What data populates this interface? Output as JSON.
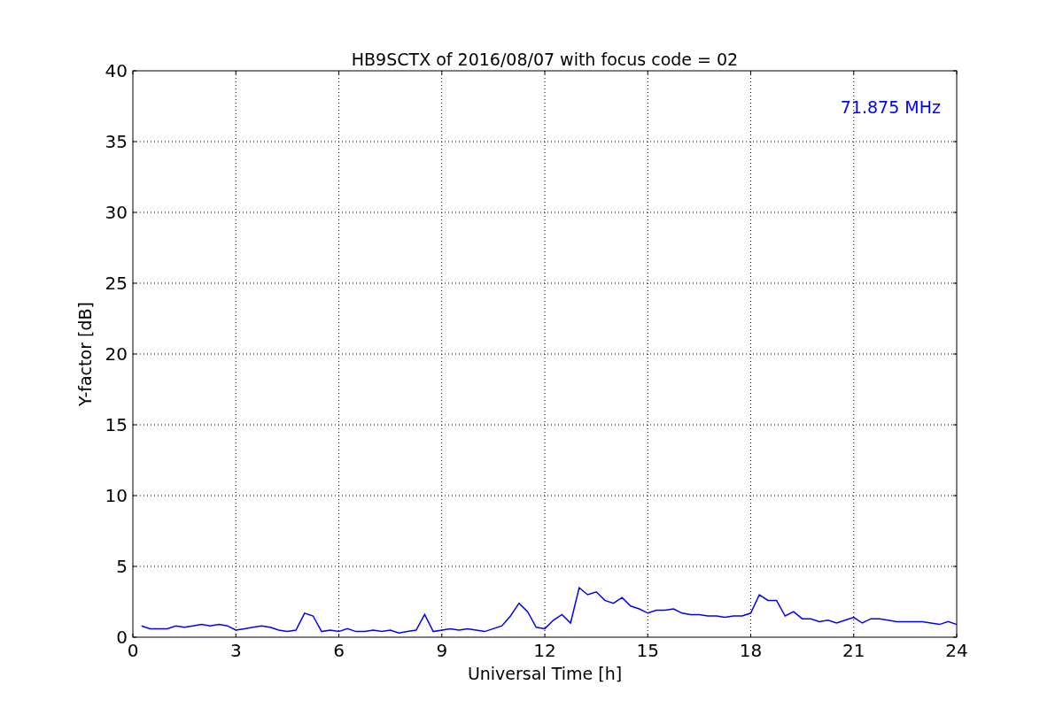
{
  "chart": {
    "chart_data": {
      "type": "line",
      "title": "HB9SCTX of 2016/08/07 with focus code = 02",
      "xlabel": "Universal Time [h]",
      "ylabel": "Y-factor [dB]",
      "x": [
        0.25,
        0.5,
        0.75,
        1,
        1.25,
        1.5,
        1.75,
        2,
        2.25,
        2.5,
        2.75,
        3,
        3.25,
        3.5,
        3.75,
        4,
        4.25,
        4.5,
        4.75,
        5,
        5.25,
        5.5,
        5.75,
        6,
        6.25,
        6.5,
        6.75,
        7,
        7.25,
        7.5,
        7.75,
        8,
        8.25,
        8.5,
        8.75,
        9,
        9.25,
        9.5,
        9.75,
        10,
        10.25,
        10.5,
        10.75,
        11,
        11.25,
        11.5,
        11.75,
        12,
        12.25,
        12.5,
        12.75,
        13,
        13.25,
        13.5,
        13.75,
        14,
        14.25,
        14.5,
        14.75,
        15,
        15.25,
        15.5,
        15.75,
        16,
        16.25,
        16.5,
        16.75,
        17,
        17.25,
        17.5,
        17.75,
        18,
        18.25,
        18.5,
        18.75,
        19,
        19.25,
        19.5,
        19.75,
        20,
        20.25,
        20.5,
        20.75,
        21,
        21.25,
        21.5,
        21.75,
        22,
        22.25,
        22.5,
        22.75,
        23,
        23.25,
        23.5,
        23.75,
        24
      ],
      "series": [
        {
          "name": "71.875 MHz",
          "color": "#0000ff",
          "values": [
            0.8,
            0.6,
            0.6,
            0.6,
            0.8,
            0.7,
            0.8,
            0.9,
            0.8,
            0.9,
            0.8,
            0.5,
            0.6,
            0.7,
            0.8,
            0.7,
            0.5,
            0.4,
            0.5,
            1.7,
            1.5,
            0.4,
            0.5,
            0.4,
            0.6,
            0.4,
            0.4,
            0.5,
            0.4,
            0.5,
            0.3,
            0.4,
            0.5,
            1.6,
            0.4,
            0.5,
            0.6,
            0.5,
            0.6,
            0.5,
            0.4,
            0.6,
            0.8,
            1.5,
            2.4,
            1.8,
            0.7,
            0.6,
            1.2,
            1.6,
            1.0,
            3.5,
            3.0,
            3.2,
            2.6,
            2.4,
            2.8,
            2.2,
            2.0,
            1.7,
            1.9,
            1.9,
            2.0,
            1.7,
            1.6,
            1.6,
            1.5,
            1.5,
            1.4,
            1.5,
            1.5,
            1.7,
            3.0,
            2.6,
            2.6,
            1.5,
            1.8,
            1.3,
            1.3,
            1.1,
            1.2,
            1.0,
            1.2,
            1.4,
            1.0,
            1.3,
            1.3,
            1.2,
            1.1,
            1.1,
            1.1,
            1.1,
            1.0,
            0.9,
            1.1,
            0.9
          ]
        }
      ],
      "grid": true,
      "xlim": [
        0,
        24
      ],
      "ylim": [
        0,
        40
      ],
      "xticks": [
        0,
        3,
        6,
        9,
        12,
        15,
        18,
        21,
        24
      ],
      "yticks": [
        0,
        5,
        10,
        15,
        20,
        25,
        30,
        35,
        40
      ]
    }
  }
}
